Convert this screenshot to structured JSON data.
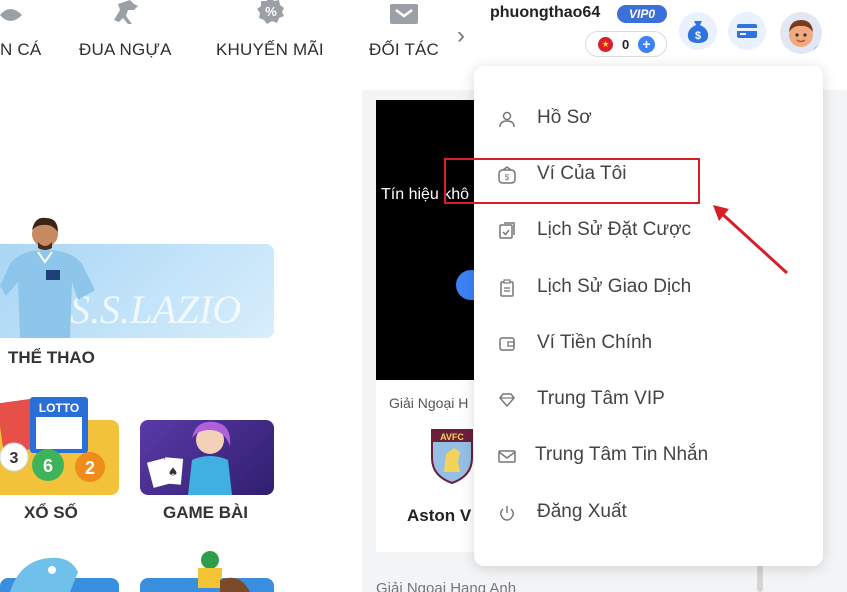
{
  "nav": {
    "items": [
      {
        "label": "N CÁ",
        "icon": "fish-icon"
      },
      {
        "label": "ĐUA NGỰA",
        "icon": "horse-icon"
      },
      {
        "label": "KHUYẾN MÃI",
        "icon": "promo-icon"
      },
      {
        "label": "ĐỐI TÁC",
        "icon": "partner-icon"
      }
    ],
    "more_icon": "chevron-right-icon"
  },
  "user": {
    "username": "phuongthao64",
    "vip_label": "VIP0",
    "balance": "0",
    "flag_icon": "vietnam-flag-icon"
  },
  "left": {
    "sports_label": "THỂ THAO",
    "sports_banner_text": "S.S.LAZIO",
    "lottery_label": "XỔ SỐ",
    "lottery_banner_text": "LOTTO",
    "cards_label": "GAME BÀI"
  },
  "middle": {
    "video_text": "Tín hiệu khô",
    "league_text": "Giải Ngoại H",
    "team_badge_text": "AVFC",
    "team_name": "Aston V",
    "league_bottom": "Giải Ngoại Hạng Anh"
  },
  "menu": {
    "items": [
      {
        "label": "Hồ Sơ",
        "icon": "user-icon"
      },
      {
        "label": "Ví Của Tôi",
        "icon": "wallet-coin-icon"
      },
      {
        "label": "Lịch Sử Đặt Cược",
        "icon": "bet-history-icon"
      },
      {
        "label": "Lịch Sử Giao Dịch",
        "icon": "transaction-history-icon"
      },
      {
        "label": "Ví Tiền Chính",
        "icon": "main-wallet-icon"
      },
      {
        "label": "Trung Tâm VIP",
        "icon": "diamond-icon"
      },
      {
        "label": "Trung Tâm Tin Nhắn",
        "icon": "mail-icon"
      },
      {
        "label": "Đăng Xuất",
        "icon": "power-icon"
      }
    ]
  },
  "colors": {
    "accent_blue": "#3b82f6",
    "annotation_red": "#d61f26",
    "vip_blue": "#3b6fd9"
  }
}
